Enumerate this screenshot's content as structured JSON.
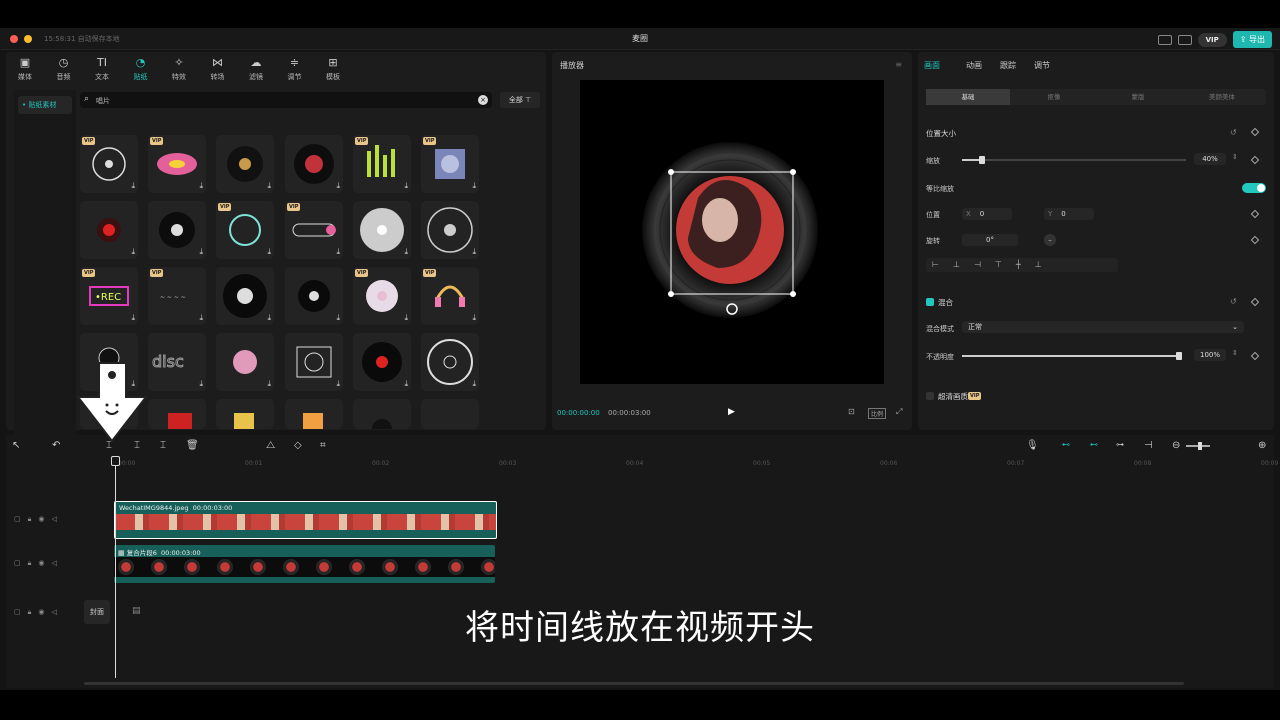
{
  "titlebar": {
    "status": "15:58:31 自动保存本地",
    "title": "麦圈",
    "vip": "VIP",
    "export": "导出"
  },
  "toolbar": [
    {
      "label": "媒体",
      "icon": "▣"
    },
    {
      "label": "音频",
      "icon": "◷"
    },
    {
      "label": "文本",
      "icon": "TI"
    },
    {
      "label": "贴纸",
      "icon": "◔",
      "active": true
    },
    {
      "label": "特效",
      "icon": "✧"
    },
    {
      "label": "转场",
      "icon": "⋈"
    },
    {
      "label": "滤镜",
      "icon": "☁"
    },
    {
      "label": "调节",
      "icon": "≑"
    },
    {
      "label": "模板",
      "icon": "⊞"
    }
  ],
  "sidebar": {
    "item": "• 贴纸素材"
  },
  "search": {
    "value": "唱片",
    "filter": "全部"
  },
  "stickers": {
    "vip_label": "VIP",
    "rows": [
      [
        1,
        1,
        0,
        0,
        1,
        1
      ],
      [
        0,
        0,
        1,
        1,
        0,
        0
      ],
      [
        1,
        1,
        0,
        0,
        1,
        1
      ],
      [
        0,
        0,
        0,
        0,
        0,
        0
      ],
      [
        0,
        0,
        0,
        0,
        0,
        0
      ]
    ]
  },
  "player": {
    "title": "播放器",
    "time_current": "00:00:00:00",
    "time_total": "00:00:03:00",
    "ratio": "比例"
  },
  "props": {
    "tabs": [
      "画面",
      "动画",
      "跟踪",
      "调节"
    ],
    "seg": [
      "基础",
      "抠像",
      "蒙版",
      "美颜美体"
    ],
    "pos_size": "位置大小",
    "scale": "缩放",
    "scale_val": "40%",
    "uniform": "等比缩放",
    "position": "位置",
    "x_label": "X",
    "x_val": "0",
    "y_label": "Y",
    "y_val": "0",
    "rotate": "旋转",
    "rotate_val": "0°",
    "blend": "混合",
    "blend_mode_label": "混合模式",
    "blend_mode": "正常",
    "opacity": "不透明度",
    "opacity_val": "100%",
    "hd": "超清画质",
    "vip": "VIP"
  },
  "timeline": {
    "ticks": [
      "00:00",
      "00:01",
      "00:02",
      "00:03",
      "00:04",
      "00:05",
      "00:06",
      "00:07",
      "00:08",
      "00:09"
    ],
    "clip1": {
      "name": "WechatIMG9844.jpeg",
      "dur": "00:00:03:00"
    },
    "clip2": {
      "name": "复合片段6",
      "dur": "00:00:03:00"
    },
    "cover": "封面"
  },
  "subtitle": "将时间线放在视频开头",
  "colors": {
    "accent": "#22c7c0",
    "clip_teal": "#17605a",
    "vip_gold": "#e9c58a"
  }
}
